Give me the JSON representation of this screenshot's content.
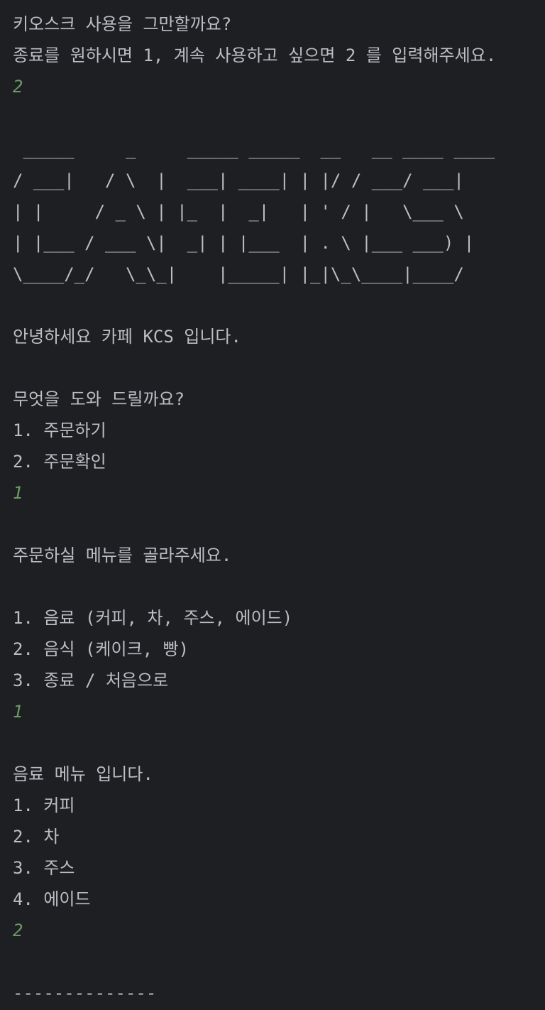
{
  "console": {
    "lines": [
      {
        "text": "키오스크 사용을 그만할까요?",
        "kind": "output"
      },
      {
        "text": "종료를 원하시면 1, 계속 사용하고 싶으면 2 를 입력해주세요.",
        "kind": "output"
      },
      {
        "text": "2",
        "kind": "input"
      },
      {
        "text": "",
        "kind": "blank"
      },
      {
        "text": " _____     _     _____ _____  __   __ ____ ____",
        "kind": "output"
      },
      {
        "text": "/ ___|   / \\  |  ___| ____| | |/ / ___/ ___|",
        "kind": "output"
      },
      {
        "text": "| |     / _ \\ | |_  |  _|   | ' / |   \\___ \\",
        "kind": "output"
      },
      {
        "text": "| |___ / ___ \\|  _| | |___  | . \\ |___ ___) |",
        "kind": "output"
      },
      {
        "text": "\\____/_/   \\_\\_|    |_____| |_|\\_\\____|____/",
        "kind": "output"
      },
      {
        "text": "",
        "kind": "blank"
      },
      {
        "text": "안녕하세요 카페 KCS 입니다.",
        "kind": "output"
      },
      {
        "text": "",
        "kind": "blank"
      },
      {
        "text": "무엇을 도와 드릴까요?",
        "kind": "output"
      },
      {
        "text": "1. 주문하기",
        "kind": "output"
      },
      {
        "text": "2. 주문확인",
        "kind": "output"
      },
      {
        "text": "1",
        "kind": "input"
      },
      {
        "text": "",
        "kind": "blank"
      },
      {
        "text": "주문하실 메뉴를 골라주세요.",
        "kind": "output"
      },
      {
        "text": "",
        "kind": "blank"
      },
      {
        "text": "1. 음료 (커피, 차, 주스, 에이드)",
        "kind": "output"
      },
      {
        "text": "2. 음식 (케이크, 빵)",
        "kind": "output"
      },
      {
        "text": "3. 종료 / 처음으로",
        "kind": "output"
      },
      {
        "text": "1",
        "kind": "input"
      },
      {
        "text": "",
        "kind": "blank"
      },
      {
        "text": "음료 메뉴 입니다.",
        "kind": "output"
      },
      {
        "text": "1. 커피",
        "kind": "output"
      },
      {
        "text": "2. 차",
        "kind": "output"
      },
      {
        "text": "3. 주스",
        "kind": "output"
      },
      {
        "text": "4. 에이드",
        "kind": "output"
      },
      {
        "text": "2",
        "kind": "input"
      },
      {
        "text": "",
        "kind": "blank"
      },
      {
        "text": "--------------",
        "kind": "output"
      }
    ]
  },
  "colors": {
    "background": "#1e1f22",
    "output_text": "#bcbec4",
    "input_text": "#6a9b63"
  }
}
